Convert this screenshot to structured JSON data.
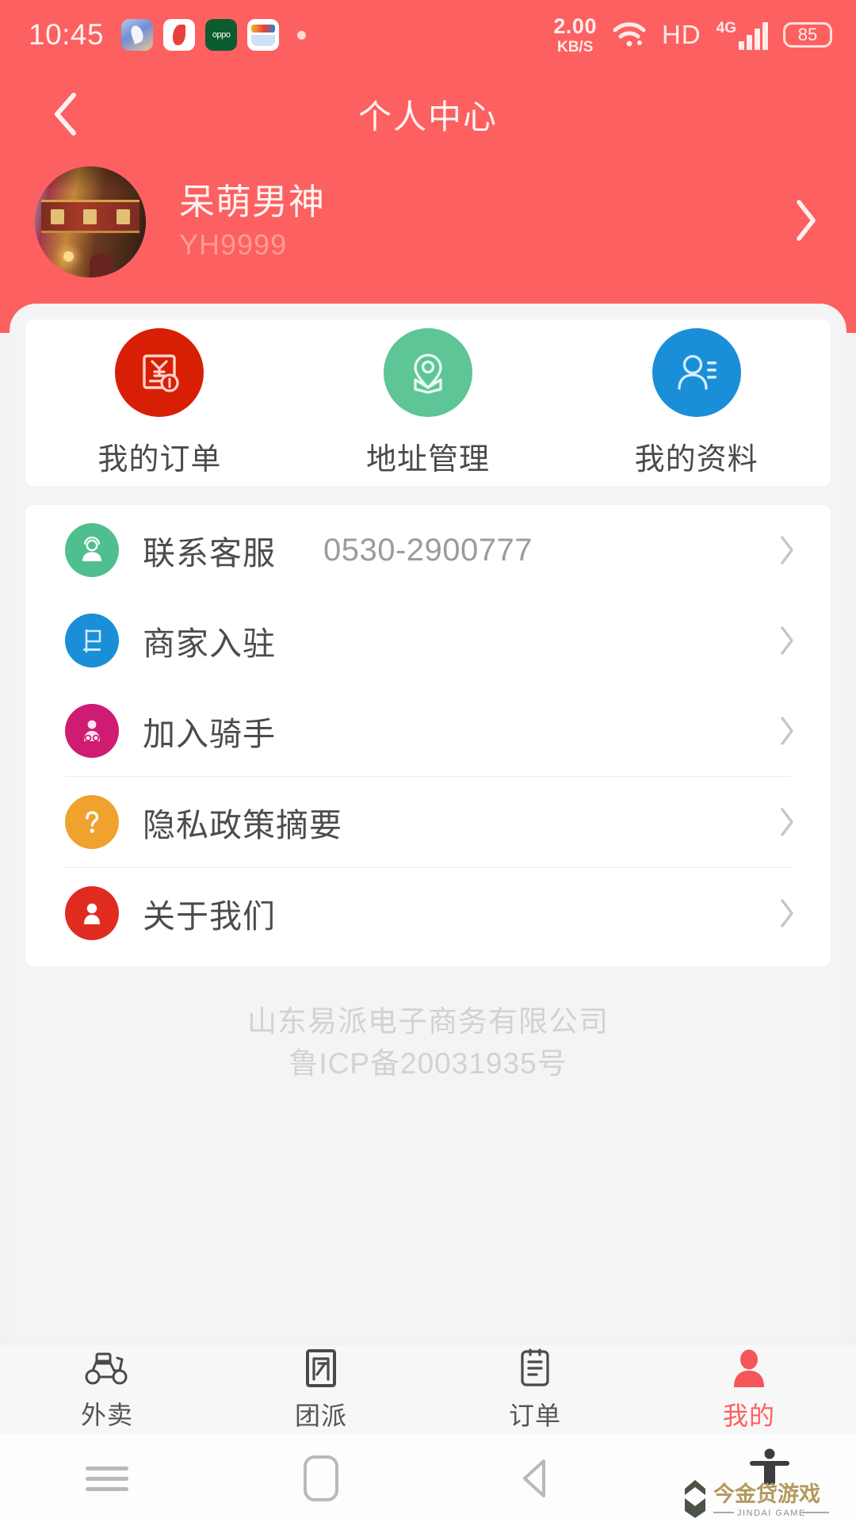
{
  "statusbar": {
    "time": "10:45",
    "app_icons": [
      "photos-icon",
      "navigation-icon",
      "oppo-icon",
      "wallet-icon",
      "more-dot-icon"
    ],
    "net_speed_value": "2.00",
    "net_speed_unit": "KB/S",
    "wifi": "wifi-icon",
    "hd": "HD",
    "network_type": "4G",
    "battery_level": "85"
  },
  "navbar": {
    "back": "back-chevron-icon",
    "title": "个人中心"
  },
  "profile": {
    "avatar": "user-avatar-photo",
    "name": "呆萌男神",
    "user_id": "YH9999",
    "arrow": "chevron-right-icon"
  },
  "quick_actions": [
    {
      "label": "我的订单",
      "icon": "order-receipt-icon",
      "color": "#d81f06"
    },
    {
      "label": "地址管理",
      "icon": "location-pin-icon",
      "color": "#5dc596"
    },
    {
      "label": "我的资料",
      "icon": "user-profile-icon",
      "color": "#1a8fd8"
    }
  ],
  "menu": [
    {
      "label": "联系客服",
      "value": "0530-2900777",
      "icon": "headset-support-icon",
      "color": "#4fc08d"
    },
    {
      "label": "商家入驻",
      "value": "",
      "icon": "shop-flag-icon",
      "color": "#1a8fd8"
    },
    {
      "label": "加入骑手",
      "value": "",
      "icon": "rider-icon",
      "color": "#cf1c72"
    },
    {
      "label": "隐私政策摘要",
      "value": "",
      "icon": "question-mark-icon",
      "color": "#f0a22e"
    },
    {
      "label": "关于我们",
      "value": "",
      "icon": "about-person-icon",
      "color": "#e02b20"
    }
  ],
  "footer": {
    "company": "山东易派电子商务有限公司",
    "icp": "鲁ICP备20031935号"
  },
  "tabbar": [
    {
      "label": "外卖",
      "icon": "scooter-icon",
      "active": false
    },
    {
      "label": "团派",
      "icon": "group-box-icon",
      "active": false
    },
    {
      "label": "订单",
      "icon": "order-list-icon",
      "active": false
    },
    {
      "label": "我的",
      "icon": "profile-person-icon",
      "active": true
    }
  ],
  "androidnav": {
    "recents": "menu-lines-icon",
    "home": "home-rounded-icon",
    "back": "back-triangle-icon"
  },
  "overlay": {
    "accessibility": "accessibility-person-icon",
    "watermark_cn": "今金贷游戏",
    "watermark_en": "JINDAI GAME"
  },
  "colors": {
    "brand_red": "#fd6060",
    "page_bg": "#f4f4f4",
    "card_bg": "#ffffff"
  }
}
